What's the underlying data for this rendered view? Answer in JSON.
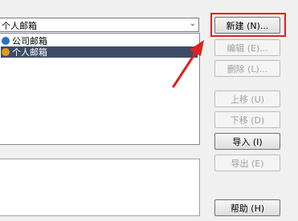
{
  "account_select": {
    "value": "个人邮箱",
    "dropdown_icon": "chevron-down-icon"
  },
  "accounts": [
    {
      "label": "公司邮箱",
      "icon": "mail-account-icon",
      "icon_color": "#2b6fc4",
      "selected": false
    },
    {
      "label": "个人邮箱",
      "icon": "mail-account-icon",
      "icon_color": "#e29a1b",
      "selected": true
    }
  ],
  "buttons": {
    "new": "新建 (N)...",
    "edit": "编辑 (E)...",
    "delete": "删除 (L)...",
    "move_up": "上移 (U)",
    "move_down": "下移 (D)",
    "import": "导入 (I)",
    "export": "导出 (E)",
    "help": "帮助 (H)"
  },
  "annotation": {
    "color": "#e02020"
  }
}
